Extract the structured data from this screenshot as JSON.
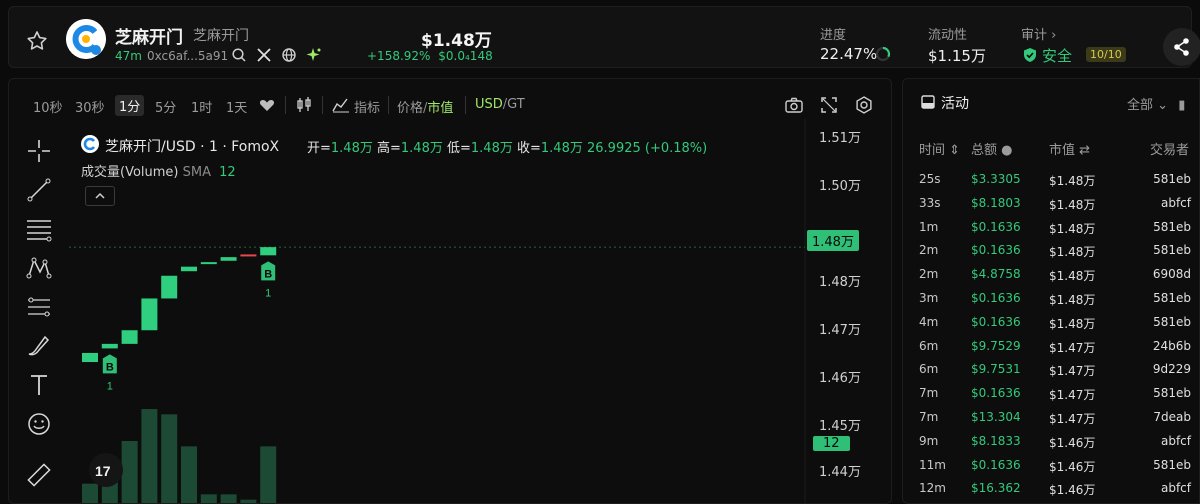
{
  "header": {
    "token_name": "芝麻开门",
    "token_subname": "芝麻开门",
    "age": "47m",
    "address": "0xc6af...5a91",
    "price": "$1.48万",
    "change_pct": "+158.92%",
    "change_abs": "$0.0₄148",
    "stats": [
      {
        "label": "进度",
        "value": "22.47%"
      },
      {
        "label": "流动性",
        "value": "$1.15万"
      },
      {
        "label": "审计 ›",
        "value": "安全"
      }
    ],
    "audit_badge": "10/10"
  },
  "toolbar": {
    "intervals": [
      "10秒",
      "30秒",
      "1分",
      "5分",
      "1时",
      "1天"
    ],
    "active_interval": "1分",
    "indicators_label": "指标",
    "price_label": "价格",
    "mcap_label": "市值",
    "currency_usd": "USD",
    "currency_gt": "GT"
  },
  "legend": {
    "title": "芝麻开门/USD · 1 · FomoX",
    "open_label": "开=",
    "open": "1.48万",
    "high_label": "高=",
    "high": "1.48万",
    "low_label": "低=",
    "low": "1.48万",
    "close_label": "收=",
    "close": "1.48万",
    "change": "26.9925 (+0.18%)",
    "volume_label": "成交量(Volume)",
    "sma_label": "SMA",
    "sma_value": "12"
  },
  "chart_data": {
    "type": "candlestick",
    "y_ticks": [
      "1.51万",
      "1.50万",
      "1.49万",
      "1.48万",
      "1.47万",
      "1.46万",
      "1.45万",
      "1.44万"
    ],
    "y_range": [
      1.4385,
      1.5125
    ],
    "y_unit": "万",
    "last_price_label": "1.48万",
    "volume_label": "12",
    "candles": [
      {
        "o": 1.4625,
        "c": 1.4645,
        "color": "up"
      },
      {
        "o": 1.4655,
        "c": 1.4665,
        "color": "up"
      },
      {
        "o": 1.4665,
        "c": 1.4695,
        "color": "up"
      },
      {
        "o": 1.4695,
        "c": 1.4765,
        "color": "up"
      },
      {
        "o": 1.4765,
        "c": 1.4815,
        "color": "up"
      },
      {
        "o": 1.4825,
        "c": 1.4835,
        "color": "up"
      },
      {
        "o": 1.4843,
        "c": 1.4845,
        "color": "up"
      },
      {
        "o": 1.4848,
        "c": 1.4856,
        "color": "up"
      },
      {
        "o": 1.486,
        "c": 1.4862,
        "color": "down"
      },
      {
        "o": 1.486,
        "c": 1.4878,
        "color": "up"
      }
    ],
    "volumes": [
      4,
      7,
      12,
      18,
      17,
      11,
      2,
      2,
      1,
      11
    ],
    "markers": [
      {
        "candle": 1,
        "label": "B",
        "count": "1"
      },
      {
        "candle": 9,
        "label": "B",
        "count": "1"
      }
    ]
  },
  "activity": {
    "title": "活动",
    "filter": "全部",
    "columns": [
      "时间",
      "总额",
      "市值",
      "交易者"
    ],
    "rows": [
      {
        "time": "25s",
        "amount": "$3.3305",
        "mc": "$1.48万",
        "trader": "581eb"
      },
      {
        "time": "33s",
        "amount": "$8.1803",
        "mc": "$1.48万",
        "trader": "abfcf"
      },
      {
        "time": "1m",
        "amount": "$0.1636",
        "mc": "$1.48万",
        "trader": "581eb"
      },
      {
        "time": "2m",
        "amount": "$0.1636",
        "mc": "$1.48万",
        "trader": "581eb"
      },
      {
        "time": "2m",
        "amount": "$4.8758",
        "mc": "$1.48万",
        "trader": "6908d"
      },
      {
        "time": "3m",
        "amount": "$0.1636",
        "mc": "$1.48万",
        "trader": "581eb"
      },
      {
        "time": "4m",
        "amount": "$0.1636",
        "mc": "$1.48万",
        "trader": "581eb"
      },
      {
        "time": "6m",
        "amount": "$9.7529",
        "mc": "$1.47万",
        "trader": "24b6b"
      },
      {
        "time": "6m",
        "amount": "$9.7531",
        "mc": "$1.47万",
        "trader": "9d229"
      },
      {
        "time": "7m",
        "amount": "$0.1636",
        "mc": "$1.47万",
        "trader": "581eb"
      },
      {
        "time": "7m",
        "amount": "$13.304",
        "mc": "$1.47万",
        "trader": "7deab"
      },
      {
        "time": "9m",
        "amount": "$8.1833",
        "mc": "$1.46万",
        "trader": "abfcf"
      },
      {
        "time": "11m",
        "amount": "$0.1636",
        "mc": "$1.46万",
        "trader": "581eb"
      },
      {
        "time": "12m",
        "amount": "$16.362",
        "mc": "$1.46万",
        "trader": "abfcf"
      }
    ]
  },
  "colors": {
    "up": "#2fcf7f",
    "down": "#e5484d",
    "accent": "#34c97b",
    "background": "#0b0b0b"
  }
}
